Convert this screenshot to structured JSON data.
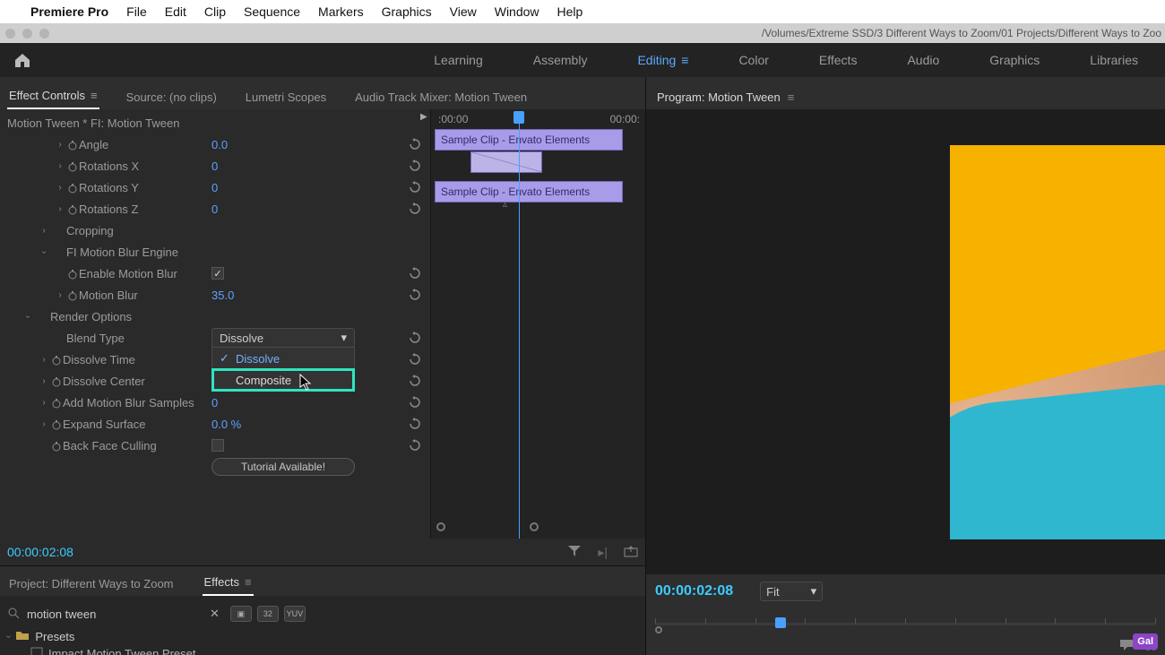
{
  "mac_menu": {
    "app": "Premiere Pro",
    "items": [
      "File",
      "Edit",
      "Clip",
      "Sequence",
      "Markers",
      "Graphics",
      "View",
      "Window",
      "Help"
    ]
  },
  "titlebar": {
    "path": "/Volumes/Extreme SSD/3 Different Ways to Zoom/01 Projects/Different Ways to Zoo"
  },
  "workspaces": {
    "items": [
      "Learning",
      "Assembly",
      "Editing",
      "Color",
      "Effects",
      "Audio",
      "Graphics",
      "Libraries"
    ],
    "active": "Editing"
  },
  "panels_left": {
    "tabs": [
      "Effect Controls",
      "Source: (no clips)",
      "Lumetri Scopes",
      "Audio Track Mixer: Motion Tween"
    ],
    "active": "Effect Controls"
  },
  "effect_controls": {
    "breadcrumb": "Motion Tween * FI: Motion Tween",
    "timeline": {
      "t0": ":00:00",
      "t1": "00:00:",
      "clip_label": "Sample Clip - Envato Elements"
    },
    "timecode": "00:00:02:08",
    "props": {
      "angle": {
        "name": "Angle",
        "value": "0.0"
      },
      "rotx": {
        "name": "Rotations X",
        "value": "0"
      },
      "roty": {
        "name": "Rotations Y",
        "value": "0"
      },
      "rotz": {
        "name": "Rotations Z",
        "value": "0"
      },
      "cropping": {
        "name": "Cropping"
      },
      "engine": {
        "name": "FI Motion Blur Engine"
      },
      "enable_mb": {
        "name": "Enable Motion Blur"
      },
      "motion_blur": {
        "name": "Motion Blur",
        "value": "35.0"
      },
      "render_options": {
        "name": "Render Options"
      },
      "blend_type": {
        "name": "Blend Type",
        "value": "Dissolve",
        "options": [
          "Dissolve",
          "Composite"
        ]
      },
      "dissolve_time": {
        "name": "Dissolve Time"
      },
      "dissolve_center": {
        "name": "Dissolve Center"
      },
      "add_mb_samples": {
        "name": "Add Motion Blur Samples",
        "value": "0"
      },
      "expand_surface": {
        "name": "Expand Surface",
        "value": "0.0 %"
      },
      "back_face": {
        "name": "Back Face Culling"
      },
      "tutorial": {
        "label": "Tutorial Available!"
      }
    }
  },
  "project_panel": {
    "tabs": [
      "Project: Different Ways to Zoom",
      "Effects"
    ],
    "active": "Effects",
    "search_value": "motion tween",
    "presets_label": "Presets",
    "preset_child": "Impact Motion Tween Preset"
  },
  "program_panel": {
    "title": "Program: Motion Tween",
    "timecode": "00:00:02:08",
    "fit": "Fit",
    "badge": "Gal"
  }
}
